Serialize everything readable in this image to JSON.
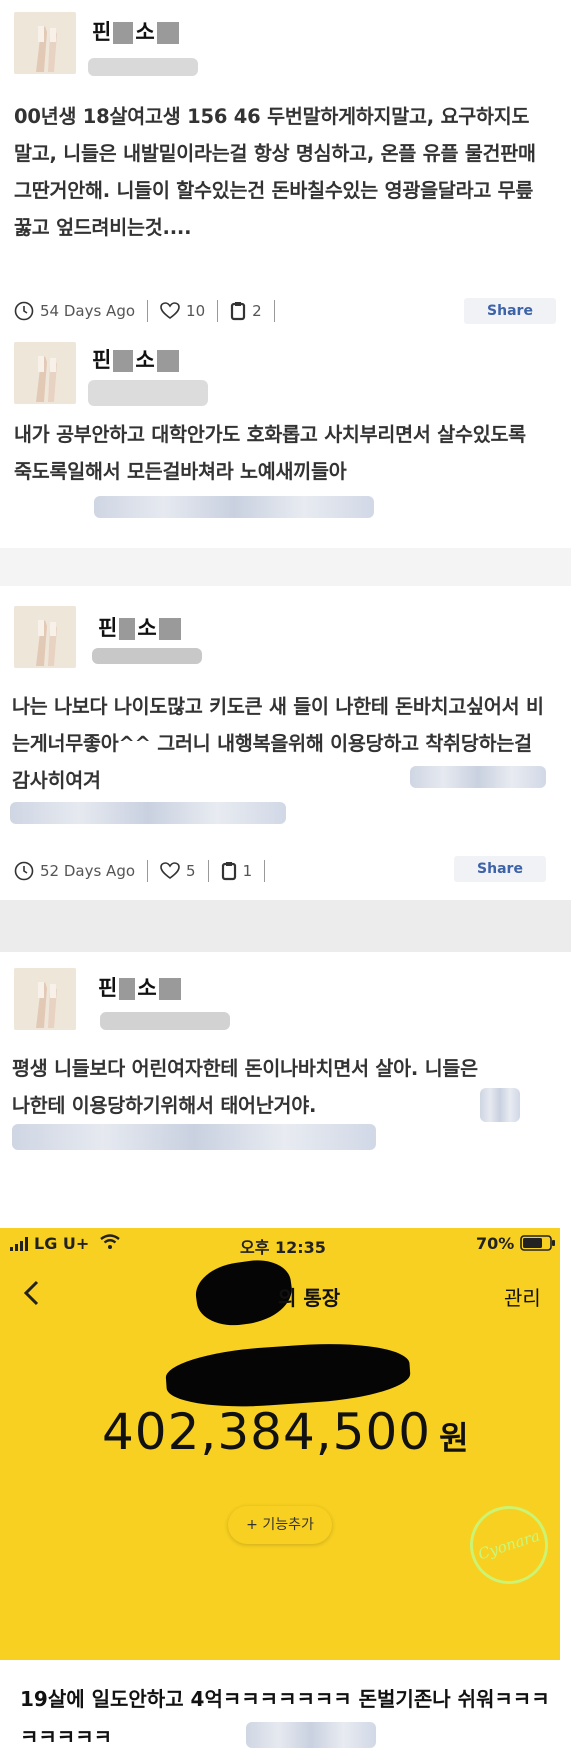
{
  "posts": [
    {
      "username_left": "핀",
      "username_right": "소",
      "body": "00년생 18살여고생 156 46 두번말하게하지말고, 요구하지도말고, 니들은 내발밑이라는걸 항상 명심하고, 온플 유플 물건판매 그딴거안해. 니들이 할수있는건 돈바칠수있는 영광을달라고 무릎꿇고 엎드려비는것....",
      "time": "54 Days Ago",
      "likes": "10",
      "reposts": "2",
      "share": "Share"
    },
    {
      "username_left": "핀",
      "username_right": "소",
      "body": "내가 공부안하고 대학안가도 호화롭고 사치부리면서 살수있도록 죽도록일해서 모든걸바쳐라 노예새끼들아"
    },
    {
      "username_left": "핀",
      "username_right": "소",
      "body": "나는 나보다 나이도많고 키도큰 새 들이 나한테 돈바치고싶어서 비는게너무좋아^^ 그러니 내행복을위해 이용당하고 착취당하는걸 감사히여겨",
      "time": "52 Days Ago",
      "likes": "5",
      "reposts": "1",
      "share": "Share"
    },
    {
      "username_left": "핀",
      "username_right": "소",
      "body": "평생 니들보다 어린여자한테 돈이나바치면서 살아. 니들은 나한테 이용당하기위해서 태어난거야."
    }
  ],
  "bank": {
    "carrier": "LG U+",
    "time": "오후 12:35",
    "battery": "70%",
    "title_suffix": "의 통장",
    "manage": "관리",
    "amount": "402,384,500",
    "currency": "원",
    "add_feature": "+ 기능추가",
    "watermark": "Cyonara"
  },
  "caption": "19살에 일도안하고 4억ㅋㅋㅋㅋㅋㅋㅋ 돈벌기존나 쉬워ㅋㅋㅋㅋㅋㅋㅋㅋ",
  "colors": {
    "bank_yellow": "#f8d021",
    "share_text": "#3d63a8"
  }
}
